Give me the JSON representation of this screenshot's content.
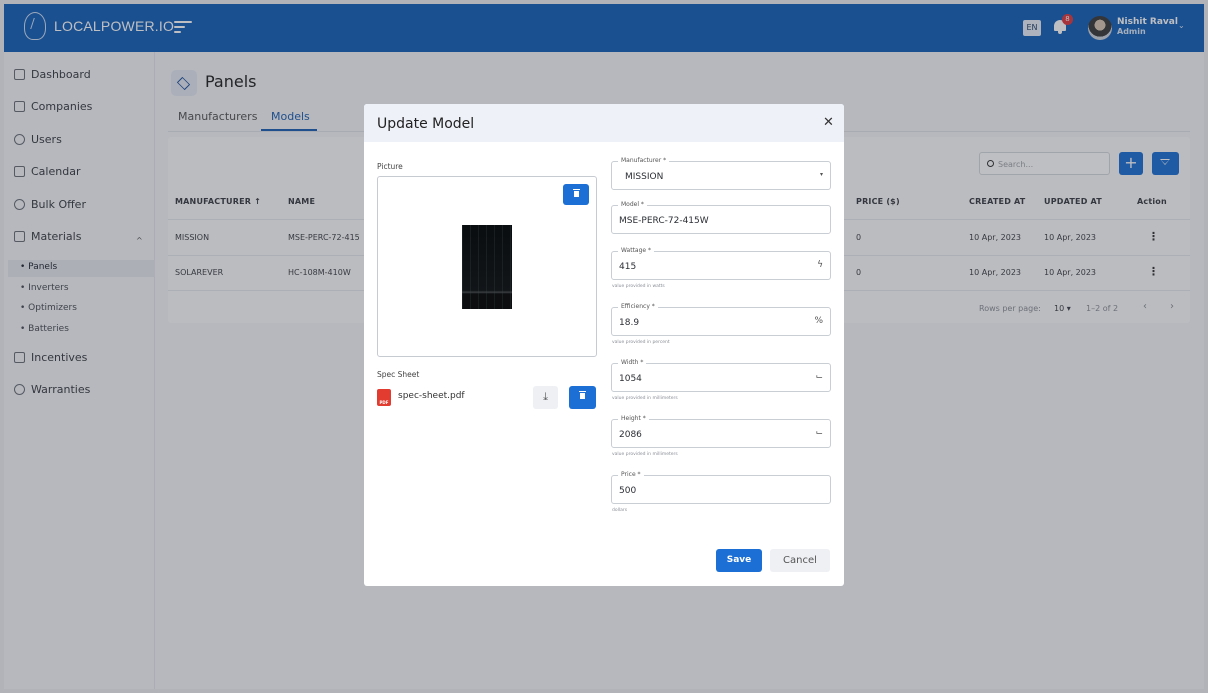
{
  "header": {
    "app_name": "LOCALPOWER.IO",
    "language": "EN",
    "notification_count": "8",
    "user_name": "Nishit Raval",
    "user_role": "Admin"
  },
  "sidebar": {
    "items": [
      {
        "label": "Dashboard",
        "icon": "grid-icon"
      },
      {
        "label": "Companies",
        "icon": "building-icon"
      },
      {
        "label": "Users",
        "icon": "users-icon"
      },
      {
        "label": "Calendar",
        "icon": "calendar-icon"
      },
      {
        "label": "Bulk Offer",
        "icon": "offer-icon"
      },
      {
        "label": "Materials",
        "icon": "layers-icon"
      },
      {
        "label": "Incentives",
        "icon": "bar-chart-icon"
      },
      {
        "label": "Warranties",
        "icon": "badge-icon"
      }
    ],
    "sub_items": [
      "Panels",
      "Inverters",
      "Optimizers",
      "Batteries"
    ]
  },
  "page": {
    "title": "Panels",
    "tabs": [
      "Manufacturers",
      "Models"
    ],
    "active_tab": "Models"
  },
  "table": {
    "search_placeholder": "Search...",
    "columns": [
      "MANUFACTURER",
      "NAME",
      "PRICE ($)",
      "CREATED AT",
      "UPDATED AT",
      "Action"
    ],
    "sort_indicator": "↑",
    "rows": [
      {
        "manufacturer": "MISSION",
        "name": "MSE-PERC-72-415",
        "price": "0",
        "created": "10 Apr, 2023",
        "updated": "10 Apr, 2023"
      },
      {
        "manufacturer": "SOLAREVER",
        "name": "HC-108M-410W",
        "price": "0",
        "created": "10 Apr, 2023",
        "updated": "10 Apr, 2023"
      }
    ],
    "rows_per_page_label": "Rows per page:",
    "rows_per_page": "10",
    "page_range": "1–2 of 2"
  },
  "modal": {
    "title": "Update Model",
    "picture_label": "Picture",
    "spec_sheet_label": "Spec Sheet",
    "spec_sheet_file": "spec-sheet.pdf",
    "pdf_badge": "PDF",
    "fields": {
      "manufacturer": {
        "label": "Manufacturer *",
        "value": "MISSION"
      },
      "model": {
        "label": "Model *",
        "value": "MSE-PERC-72-415W"
      },
      "wattage": {
        "label": "Wattage *",
        "value": "415",
        "help": "value provided in watts"
      },
      "efficiency": {
        "label": "Efficiency *",
        "value": "18.9",
        "help": "value provided in percent",
        "unit": "%"
      },
      "width": {
        "label": "Width *",
        "value": "1054",
        "help": "value provided in millimeters"
      },
      "height": {
        "label": "Height *",
        "value": "2086",
        "help": "value provided in millimeters"
      },
      "price": {
        "label": "Price *",
        "value": "500",
        "help": "dollars"
      }
    },
    "save_label": "Save",
    "cancel_label": "Cancel"
  },
  "colors": {
    "header_bg": "#1660b8",
    "primary": "#1c6fd5",
    "danger": "#e23b30"
  }
}
